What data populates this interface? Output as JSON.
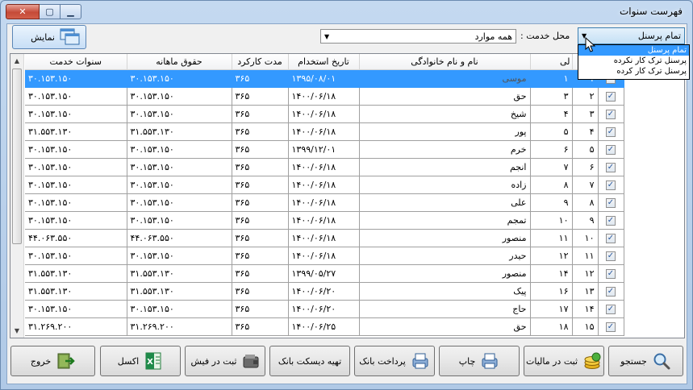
{
  "window": {
    "title": "فهرست سنوات"
  },
  "toolbar": {
    "show_label": "نمایش",
    "service_label": "محل خدمت :",
    "service_value": "همه موارد",
    "personnel_value": "تمام پرسنل",
    "personnel_options": [
      "تمام پرسنل",
      "پرسنل ترک کار نکرده",
      "پرسنل ترک کار کرده"
    ]
  },
  "table": {
    "headers": {
      "service_years": "سنوات خدمت",
      "monthly_salary": "حقوق ماهانه",
      "work_period": "مدت کارکرد",
      "hire_date": "تاریخ استخدام",
      "full_name": "نام و نام خانوادگی",
      "code": "لی"
    },
    "rows": [
      {
        "service": "۳۰.۱۵۳.۱۵۰",
        "salary": "۳۰.۱۵۳.۱۵۰",
        "period": "۳۶۵",
        "date": "۱۳۹۵/۰۸/۰۱",
        "name": "موسی",
        "code": "۱",
        "idx": "۱",
        "checked": true
      },
      {
        "service": "۳۰.۱۵۳.۱۵۰",
        "salary": "۳۰.۱۵۳.۱۵۰",
        "period": "۳۶۵",
        "date": "۱۴۰۰/۰۶/۱۸",
        "name": "حق",
        "code": "۳",
        "idx": "۲",
        "checked": true
      },
      {
        "service": "۳۰.۱۵۳.۱۵۰",
        "salary": "۳۰.۱۵۳.۱۵۰",
        "period": "۳۶۵",
        "date": "۱۴۰۰/۰۶/۱۸",
        "name": "شیخ",
        "code": "۴",
        "idx": "۳",
        "checked": true
      },
      {
        "service": "۳۱.۵۵۳.۱۳۰",
        "salary": "۳۱.۵۵۳.۱۳۰",
        "period": "۳۶۵",
        "date": "۱۴۰۰/۰۶/۱۸",
        "name": "پور",
        "code": "۵",
        "idx": "۴",
        "checked": true
      },
      {
        "service": "۳۰.۱۵۳.۱۵۰",
        "salary": "۳۰.۱۵۳.۱۵۰",
        "period": "۳۶۵",
        "date": "۱۳۹۹/۱۲/۰۱",
        "name": "خرم",
        "code": "۶",
        "idx": "۵",
        "checked": true
      },
      {
        "service": "۳۰.۱۵۳.۱۵۰",
        "salary": "۳۰.۱۵۳.۱۵۰",
        "period": "۳۶۵",
        "date": "۱۴۰۰/۰۶/۱۸",
        "name": "انجم",
        "code": "۷",
        "idx": "۶",
        "checked": true
      },
      {
        "service": "۳۰.۱۵۳.۱۵۰",
        "salary": "۳۰.۱۵۳.۱۵۰",
        "period": "۳۶۵",
        "date": "۱۴۰۰/۰۶/۱۸",
        "name": "زاده",
        "code": "۸",
        "idx": "۷",
        "checked": true
      },
      {
        "service": "۳۰.۱۵۳.۱۵۰",
        "salary": "۳۰.۱۵۳.۱۵۰",
        "period": "۳۶۵",
        "date": "۱۴۰۰/۰۶/۱۸",
        "name": "علی",
        "code": "۹",
        "idx": "۸",
        "checked": true
      },
      {
        "service": "۳۰.۱۵۳.۱۵۰",
        "salary": "۳۰.۱۵۳.۱۵۰",
        "period": "۳۶۵",
        "date": "۱۴۰۰/۰۶/۱۸",
        "name": "تمجم",
        "code": "۱۰",
        "idx": "۹",
        "checked": true
      },
      {
        "service": "۴۴.۰۶۳.۵۵۰",
        "salary": "۴۴.۰۶۳.۵۵۰",
        "period": "۳۶۵",
        "date": "۱۴۰۰/۰۶/۱۸",
        "name": "منصور",
        "code": "۱۱",
        "idx": "۱۰",
        "checked": true
      },
      {
        "service": "۳۰.۱۵۳.۱۵۰",
        "salary": "۳۰.۱۵۳.۱۵۰",
        "period": "۳۶۵",
        "date": "۱۴۰۰/۰۶/۱۸",
        "name": "حیدر",
        "code": "۱۲",
        "idx": "۱۱",
        "checked": true
      },
      {
        "service": "۳۱.۵۵۳.۱۳۰",
        "salary": "۳۱.۵۵۳.۱۳۰",
        "period": "۳۶۵",
        "date": "۱۳۹۹/۰۵/۲۷",
        "name": "منصور",
        "code": "۱۴",
        "idx": "۱۲",
        "checked": true
      },
      {
        "service": "۳۱.۵۵۳.۱۳۰",
        "salary": "۳۱.۵۵۳.۱۳۰",
        "period": "۳۶۵",
        "date": "۱۴۰۰/۰۶/۲۰",
        "name": "پیک",
        "code": "۱۶",
        "idx": "۱۳",
        "checked": true
      },
      {
        "service": "۳۰.۱۵۳.۱۵۰",
        "salary": "۳۰.۱۵۳.۱۵۰",
        "period": "۳۶۵",
        "date": "۱۴۰۰/۰۶/۲۰",
        "name": "حاج",
        "code": "۱۷",
        "idx": "۱۴",
        "checked": true
      },
      {
        "service": "۳۱.۲۶۹.۲۰۰",
        "salary": "۳۱.۲۶۹.۲۰۰",
        "period": "۳۶۵",
        "date": "۱۴۰۰/۰۶/۲۵",
        "name": "حق",
        "code": "۱۸",
        "idx": "۱۵",
        "checked": true
      }
    ]
  },
  "footer": {
    "search": "جستجو",
    "tax": "ثبت در مالیات",
    "print": "چاپ",
    "bank_payment": "پرداخت بانک",
    "bank_disk": "تهیه دیسکت بانک",
    "slip": "ثبت در فیش",
    "excel": "اکسل",
    "exit": "خروج"
  },
  "colors": {
    "selection": "#3399ff",
    "title_bar": "#c4d9f0",
    "close_button": "#c54a38"
  }
}
